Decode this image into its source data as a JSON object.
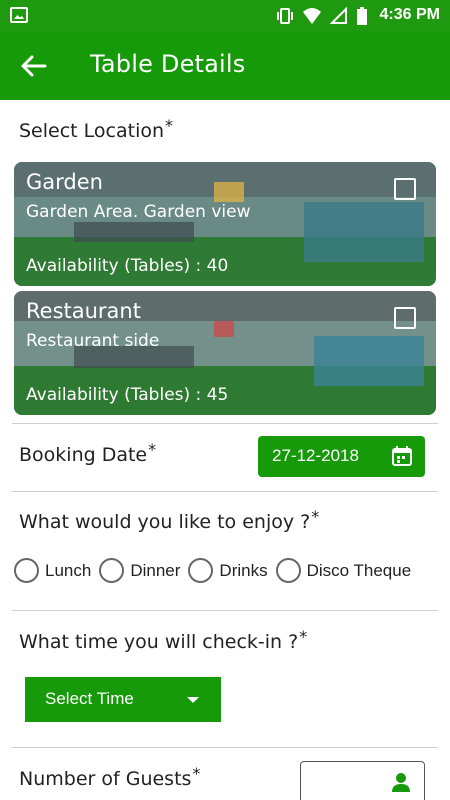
{
  "status_bar": {
    "time": "4:36 PM"
  },
  "app_bar": {
    "title": "Table Details"
  },
  "location_section": {
    "label": "Select Location",
    "required_mark": "*"
  },
  "locations": [
    {
      "name": "Garden",
      "description": "Garden Area. Garden view",
      "availability": "Availability (Tables) : 40",
      "checked": false
    },
    {
      "name": "Restaurant",
      "description": "Restaurant side",
      "availability": "Availability (Tables) : 45",
      "checked": false
    }
  ],
  "booking_date": {
    "label": "Booking Date",
    "required_mark": "*",
    "value": "27-12-2018"
  },
  "enjoy": {
    "label": "What would you like to enjoy ?",
    "required_mark": "*",
    "options": [
      "Lunch",
      "Dinner",
      "Drinks",
      "Disco Theque"
    ]
  },
  "checkin": {
    "label": "What time you will check-in ?",
    "required_mark": "*",
    "select_label": "Select Time"
  },
  "guests": {
    "label": "Number of Guests",
    "required_mark": "*"
  },
  "colors": {
    "primary": "#169a0a",
    "status_bar": "#1f9a10"
  }
}
